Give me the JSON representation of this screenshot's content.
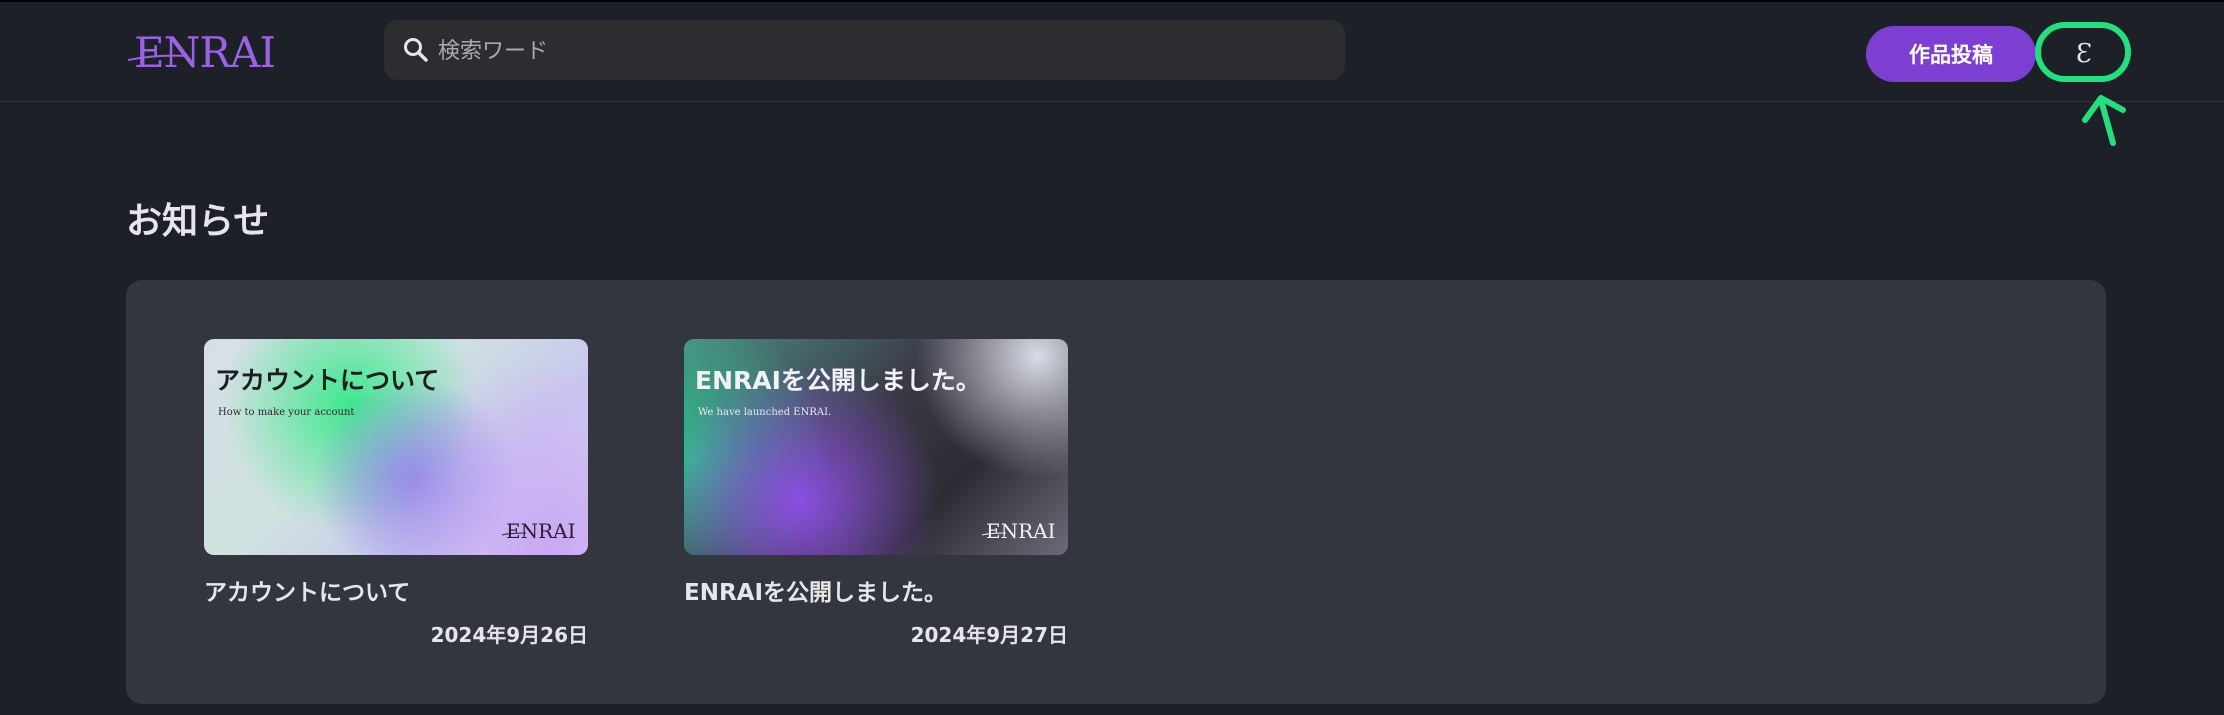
{
  "header": {
    "logo_text": "ENRAI",
    "search_placeholder": "検索ワード",
    "post_button_label": "作品投稿",
    "avatar_letter": "Ɛ"
  },
  "main": {
    "title": "お知らせ",
    "cards": [
      {
        "thumb_title": "アカウントについて",
        "thumb_subtitle": "How to make your account",
        "title": "アカウントについて",
        "date": "2024年9月26日"
      },
      {
        "thumb_title": "ENRAIを公開しました。",
        "thumb_subtitle": "We have launched ENRAI.",
        "title": "ENRAIを公開しました。",
        "date": "2024年9月27日"
      }
    ]
  },
  "colors": {
    "background": "#1e2028",
    "panel": "#33353f",
    "accent": "#7c3fd2",
    "annotation": "#22e07e"
  }
}
